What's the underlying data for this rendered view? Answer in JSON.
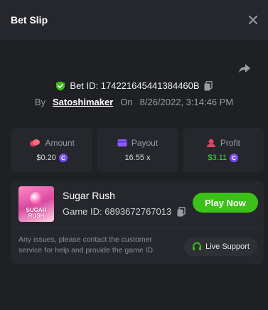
{
  "modal": {
    "title": "Bet Slip",
    "bet_id_label": "Bet ID: 174221645441384460B",
    "by_label": "By",
    "username": "Satoshimaker",
    "on_label": "On",
    "date": "8/26/2022, 3:14:46 PM"
  },
  "stats": {
    "amount": {
      "label": "Amount",
      "value": "$0.20",
      "icon": "coins-icon"
    },
    "payout": {
      "label": "Payout",
      "value": "16.55 x",
      "icon": "card-icon"
    },
    "profit": {
      "label": "Profit",
      "value": "$3.11",
      "icon": "profit-icon"
    }
  },
  "game": {
    "name": "Sugar Rush",
    "game_id_label": "Game ID: 6893672767013",
    "thumb_text": "SUGAR RUSH",
    "play_label": "Play Now"
  },
  "support": {
    "note": "Any issues, please contact the customer service for help and provide the game ID.",
    "live_label": "Live Support"
  },
  "colors": {
    "accent_green": "#3bc117",
    "profit_green": "#3ddc3a",
    "coin_purple": "#7b4dff",
    "amount_red": "#e0465f",
    "payout_purple": "#8c5cff"
  }
}
